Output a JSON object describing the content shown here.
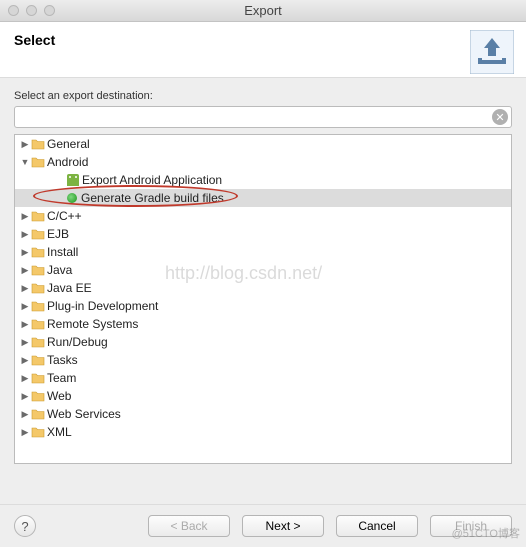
{
  "window": {
    "title": "Export"
  },
  "header": {
    "title": "Select"
  },
  "body": {
    "label": "Select an export destination:",
    "search_value": ""
  },
  "tree": {
    "items": [
      {
        "label": "General",
        "depth": 1,
        "expanded": false,
        "icon": "folder",
        "selected": false
      },
      {
        "label": "Android",
        "depth": 1,
        "expanded": true,
        "icon": "folder",
        "selected": false
      },
      {
        "label": "Export Android Application",
        "depth": 3,
        "expanded": null,
        "icon": "android",
        "selected": false
      },
      {
        "label": "Generate Gradle build files",
        "depth": 3,
        "expanded": null,
        "icon": "gradle",
        "selected": true
      },
      {
        "label": "C/C++",
        "depth": 1,
        "expanded": false,
        "icon": "folder",
        "selected": false
      },
      {
        "label": "EJB",
        "depth": 1,
        "expanded": false,
        "icon": "folder",
        "selected": false
      },
      {
        "label": "Install",
        "depth": 1,
        "expanded": false,
        "icon": "folder",
        "selected": false
      },
      {
        "label": "Java",
        "depth": 1,
        "expanded": false,
        "icon": "folder",
        "selected": false
      },
      {
        "label": "Java EE",
        "depth": 1,
        "expanded": false,
        "icon": "folder",
        "selected": false
      },
      {
        "label": "Plug-in Development",
        "depth": 1,
        "expanded": false,
        "icon": "folder",
        "selected": false
      },
      {
        "label": "Remote Systems",
        "depth": 1,
        "expanded": false,
        "icon": "folder",
        "selected": false
      },
      {
        "label": "Run/Debug",
        "depth": 1,
        "expanded": false,
        "icon": "folder",
        "selected": false
      },
      {
        "label": "Tasks",
        "depth": 1,
        "expanded": false,
        "icon": "folder",
        "selected": false
      },
      {
        "label": "Team",
        "depth": 1,
        "expanded": false,
        "icon": "folder",
        "selected": false
      },
      {
        "label": "Web",
        "depth": 1,
        "expanded": false,
        "icon": "folder",
        "selected": false
      },
      {
        "label": "Web Services",
        "depth": 1,
        "expanded": false,
        "icon": "folder",
        "selected": false
      },
      {
        "label": "XML",
        "depth": 1,
        "expanded": false,
        "icon": "folder",
        "selected": false
      }
    ]
  },
  "footer": {
    "back": "< Back",
    "next": "Next >",
    "cancel": "Cancel",
    "finish": "Finish"
  },
  "watermark": {
    "url": "http://blog.csdn.net/",
    "corner": "@51CTO博客"
  }
}
